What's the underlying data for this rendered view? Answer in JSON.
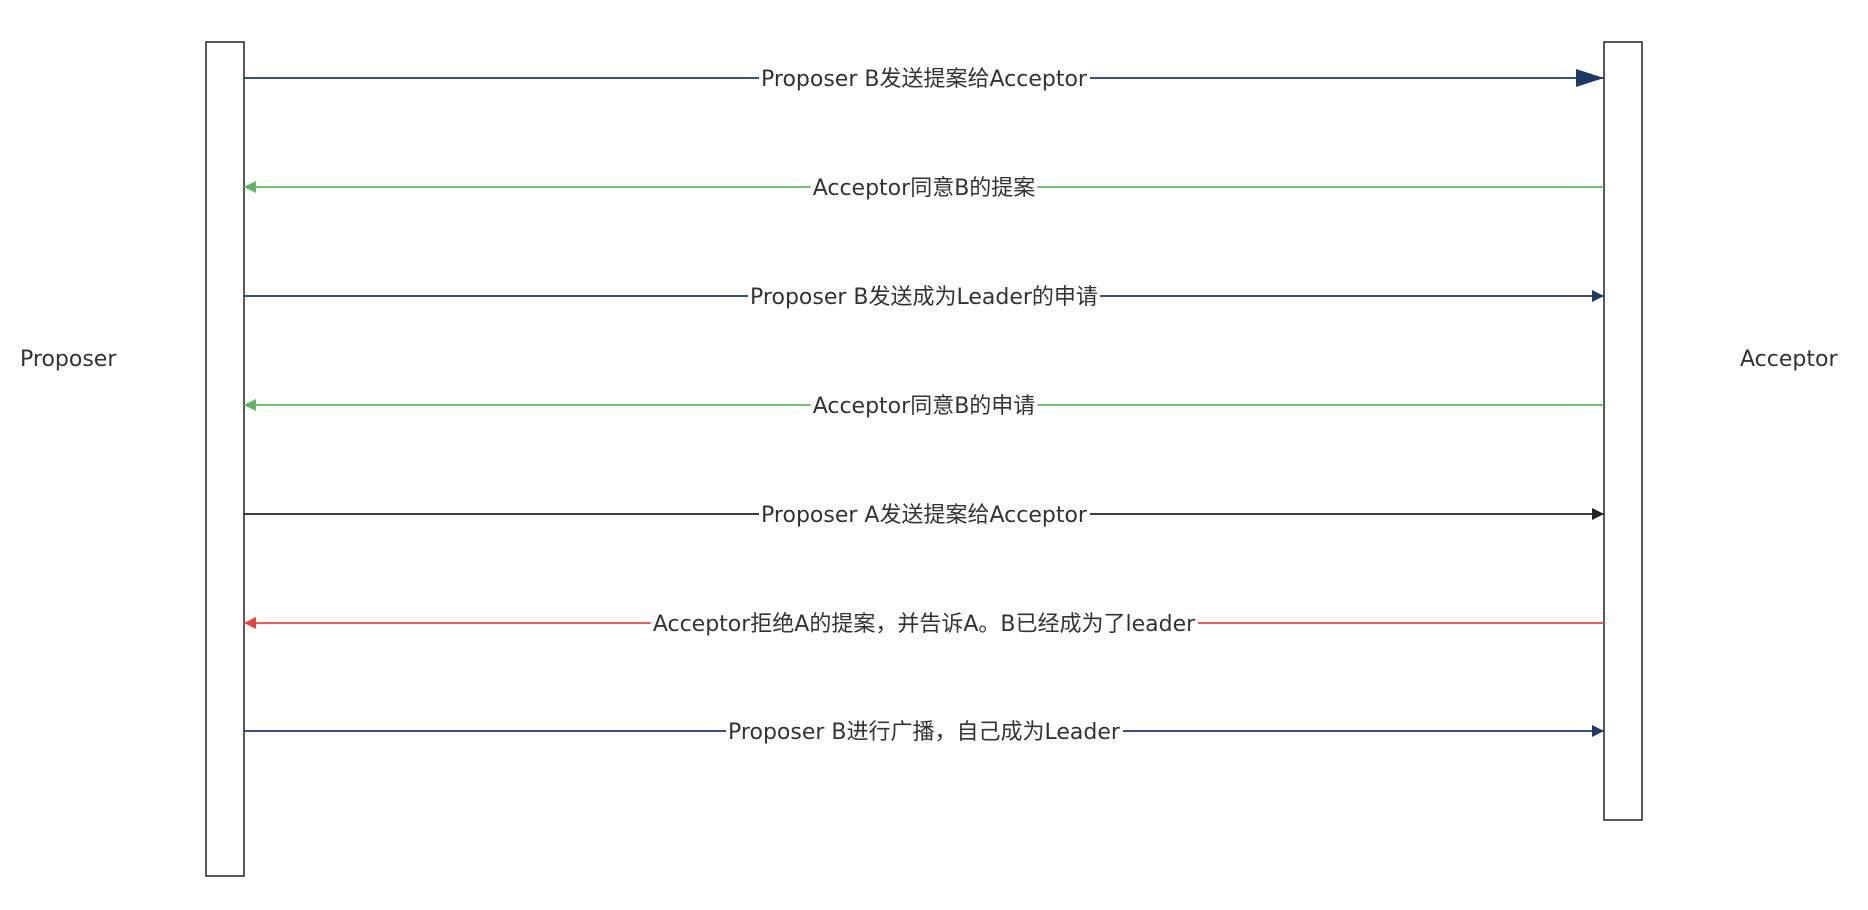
{
  "participants": {
    "left": {
      "label": "Proposer"
    },
    "right": {
      "label": "Acceptor"
    }
  },
  "colors": {
    "request": "#1f3864",
    "accept": "#5cb85c",
    "neutral": "#222222",
    "reject": "#e8443a",
    "text": "#333333"
  },
  "messages": [
    {
      "label": "Proposer B发送提案给Acceptor",
      "direction": "right",
      "color": "request"
    },
    {
      "label": "Acceptor同意B的提案",
      "direction": "left",
      "color": "accept"
    },
    {
      "label": "Proposer B发送成为Leader的申请",
      "direction": "right",
      "color": "request"
    },
    {
      "label": "Acceptor同意B的申请",
      "direction": "left",
      "color": "accept"
    },
    {
      "label": "Proposer A发送提案给Acceptor",
      "direction": "right",
      "color": "neutral"
    },
    {
      "label": "Acceptor拒绝A的提案，并告诉A。B已经成为了leader",
      "direction": "left",
      "color": "reject"
    },
    {
      "label": "Proposer B进行广播，自己成为Leader",
      "direction": "right",
      "color": "request"
    }
  ]
}
